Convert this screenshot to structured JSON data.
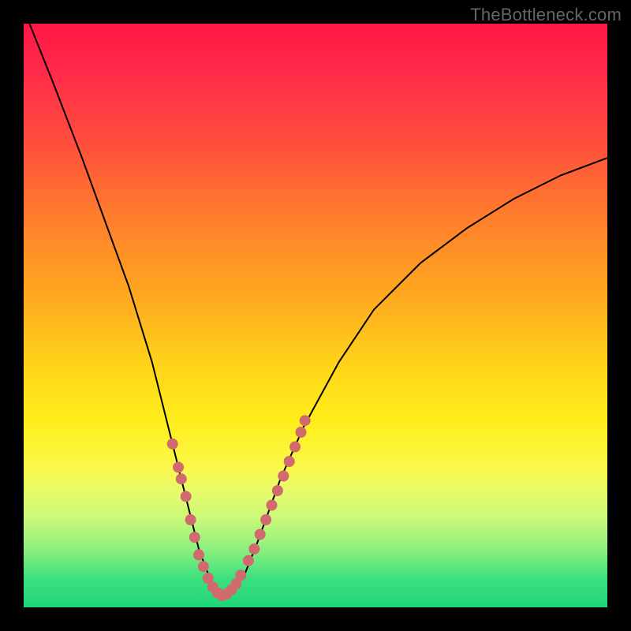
{
  "watermark": "TheBottleneck.com",
  "colors": {
    "frame": "#000000",
    "curve": "#000000",
    "dots": "#d16a6e",
    "gradient_top": "#ff1744",
    "gradient_mid": "#ffd21a",
    "gradient_bottom": "#1fd67a"
  },
  "chart_data": {
    "type": "line",
    "title": "",
    "xlabel": "",
    "ylabel": "",
    "xlim": [
      0,
      100
    ],
    "ylim": [
      0,
      100
    ],
    "grid": false,
    "legend": false,
    "annotations": [
      "TheBottleneck.com"
    ],
    "series": [
      {
        "name": "bottleneck-curve",
        "x": [
          1,
          5,
          10,
          14,
          18,
          22,
          25,
          27,
          28.5,
          30,
          31.5,
          33,
          34.5,
          36,
          38,
          40,
          44,
          48,
          54,
          60,
          68,
          76,
          84,
          92,
          100
        ],
        "y": [
          100,
          90,
          77,
          66,
          55,
          42,
          30,
          22,
          16,
          10,
          6,
          3,
          2,
          3,
          6,
          11,
          22,
          31,
          42,
          51,
          59,
          65,
          70,
          74,
          77
        ]
      }
    ],
    "minimum_x": 34,
    "dot_clusters": [
      {
        "name": "left-arm-dots",
        "points": [
          {
            "x": 25.5,
            "y": 28
          },
          {
            "x": 26.5,
            "y": 24
          },
          {
            "x": 27.0,
            "y": 22
          },
          {
            "x": 27.8,
            "y": 19
          },
          {
            "x": 28.6,
            "y": 15
          },
          {
            "x": 29.3,
            "y": 12
          },
          {
            "x": 30.0,
            "y": 9
          },
          {
            "x": 30.8,
            "y": 7
          }
        ]
      },
      {
        "name": "valley-dots",
        "points": [
          {
            "x": 31.6,
            "y": 5
          },
          {
            "x": 32.4,
            "y": 3.5
          },
          {
            "x": 33.2,
            "y": 2.5
          },
          {
            "x": 34.0,
            "y": 2
          },
          {
            "x": 34.8,
            "y": 2.3
          },
          {
            "x": 35.6,
            "y": 3
          },
          {
            "x": 36.4,
            "y": 4
          },
          {
            "x": 37.2,
            "y": 5.5
          }
        ]
      },
      {
        "name": "right-arm-dots",
        "points": [
          {
            "x": 38.5,
            "y": 8
          },
          {
            "x": 39.5,
            "y": 10
          },
          {
            "x": 40.5,
            "y": 12.5
          },
          {
            "x": 41.5,
            "y": 15
          },
          {
            "x": 42.5,
            "y": 17.5
          },
          {
            "x": 43.5,
            "y": 20
          },
          {
            "x": 44.5,
            "y": 22.5
          },
          {
            "x": 45.5,
            "y": 25
          },
          {
            "x": 46.5,
            "y": 27.5
          },
          {
            "x": 47.5,
            "y": 30
          },
          {
            "x": 48.2,
            "y": 32
          }
        ]
      }
    ]
  }
}
